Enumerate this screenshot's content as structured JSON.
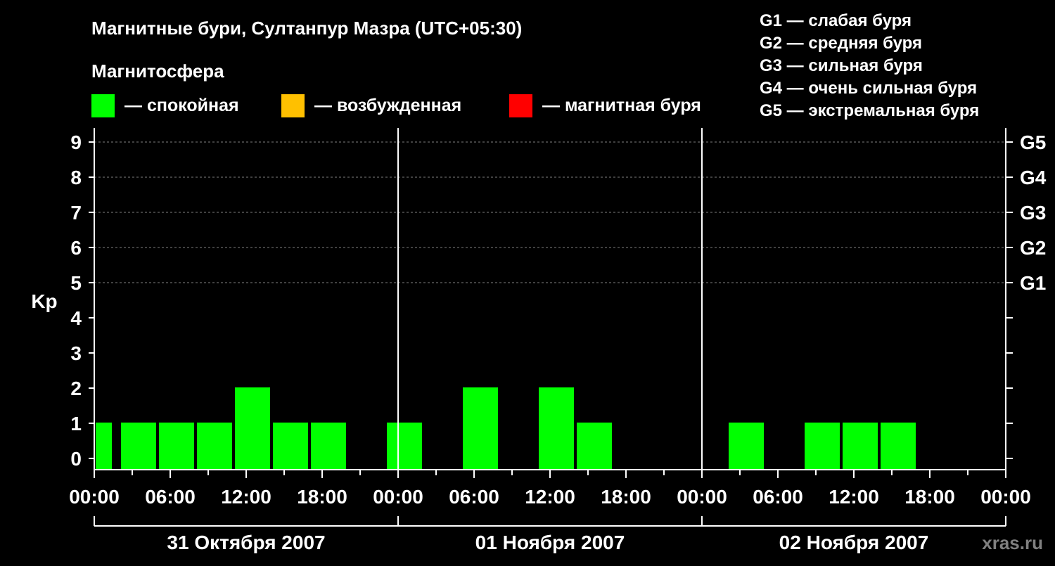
{
  "title": "Магнитные бури, Султанпур Мазра (UTC+05:30)",
  "subtitle": "Магнитосфера",
  "legend": [
    {
      "label": "— спокойная",
      "color": "#00ff00"
    },
    {
      "label": "— возбужденная",
      "color": "#ffc000"
    },
    {
      "label": "— магнитная буря",
      "color": "#ff0000"
    }
  ],
  "storm_legend": [
    "G1 — слабая буря",
    "G2 — средняя буря",
    "G3 — сильная буря",
    "G4 — очень сильная буря",
    "G5 — экстремальная буря"
  ],
  "watermark": "xras.ru",
  "colors": {
    "background": "#000000",
    "foreground": "#ffffff",
    "grid": "#808080",
    "quiet": "#00ff00",
    "excited": "#ffc000",
    "storm": "#ff0000"
  },
  "chart_data": {
    "type": "bar",
    "ylabel": "Kp",
    "ylim": [
      0,
      9
    ],
    "yticks": [
      "0",
      "1",
      "2",
      "3",
      "4",
      "5",
      "6",
      "7",
      "8",
      "9"
    ],
    "right_ticks": [
      {
        "kp": 5,
        "label": "G1"
      },
      {
        "kp": 6,
        "label": "G2"
      },
      {
        "kp": 7,
        "label": "G3"
      },
      {
        "kp": 8,
        "label": "G4"
      },
      {
        "kp": 9,
        "label": "G5"
      }
    ],
    "grid_dashed_at": [
      5,
      6,
      7,
      8,
      9
    ],
    "x_range_hours": [
      0,
      72
    ],
    "xtick_labels": [
      "00:00",
      "06:00",
      "12:00",
      "18:00",
      "00:00",
      "06:00",
      "12:00",
      "18:00",
      "00:00",
      "06:00",
      "12:00",
      "18:00",
      "00:00"
    ],
    "days": [
      "31 Октября 2007",
      "01 Ноября 2007",
      "02 Ноября 2007"
    ],
    "bars": [
      {
        "start": "31 Октября 2007 00:00",
        "end": "31 Октября 2007 01:30",
        "kp": 1,
        "level": "quiet"
      },
      {
        "start": "31 Октября 2007 02:00",
        "end": "31 Октября 2007 05:00",
        "kp": 1,
        "level": "quiet"
      },
      {
        "start": "31 Октября 2007 05:00",
        "end": "31 Октября 2007 08:00",
        "kp": 1,
        "level": "quiet"
      },
      {
        "start": "31 Октября 2007 08:00",
        "end": "31 Октября 2007 11:00",
        "kp": 1,
        "level": "quiet"
      },
      {
        "start": "31 Октября 2007 11:00",
        "end": "31 Октября 2007 14:00",
        "kp": 2,
        "level": "quiet"
      },
      {
        "start": "31 Октября 2007 14:00",
        "end": "31 Октября 2007 17:00",
        "kp": 1,
        "level": "quiet"
      },
      {
        "start": "31 Октября 2007 17:00",
        "end": "31 Октября 2007 20:00",
        "kp": 1,
        "level": "quiet"
      },
      {
        "start": "31 Октября 2007 23:00",
        "end": "01 Ноября 2007 02:00",
        "kp": 1,
        "level": "quiet"
      },
      {
        "start": "01 Ноября 2007 05:00",
        "end": "01 Ноября 2007 08:00",
        "kp": 2,
        "level": "quiet"
      },
      {
        "start": "01 Ноября 2007 11:00",
        "end": "01 Ноября 2007 14:00",
        "kp": 2,
        "level": "quiet"
      },
      {
        "start": "01 Ноября 2007 14:00",
        "end": "01 Ноября 2007 17:00",
        "kp": 1,
        "level": "quiet"
      },
      {
        "start": "02 Ноября 2007 02:00",
        "end": "02 Ноября 2007 05:00",
        "kp": 1,
        "level": "quiet"
      },
      {
        "start": "02 Ноября 2007 08:00",
        "end": "02 Ноября 2007 11:00",
        "kp": 1,
        "level": "quiet"
      },
      {
        "start": "02 Ноября 2007 11:00",
        "end": "02 Ноября 2007 14:00",
        "kp": 1,
        "level": "quiet"
      },
      {
        "start": "02 Ноября 2007 14:00",
        "end": "02 Ноября 2007 17:00",
        "kp": 1,
        "level": "quiet"
      }
    ]
  }
}
